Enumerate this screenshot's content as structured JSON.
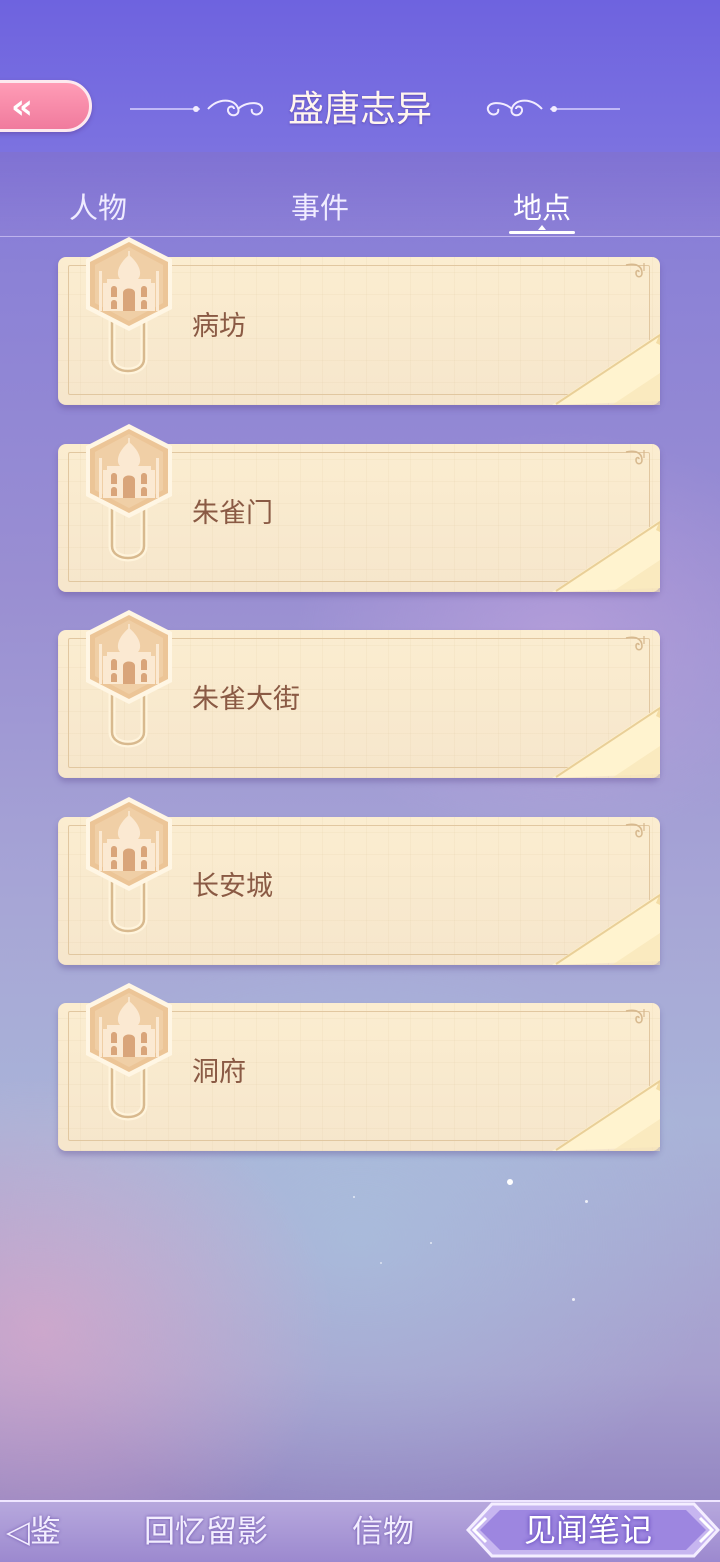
{
  "header": {
    "title": "盛唐志异",
    "back_icon": "double-chevron-left-icon",
    "back_glyph": "«"
  },
  "tabs": [
    {
      "label": "人物",
      "selected": false
    },
    {
      "label": "事件",
      "selected": false
    },
    {
      "label": "地点",
      "selected": true
    }
  ],
  "locations": [
    {
      "name": "病坊",
      "icon": "palace-badge-icon"
    },
    {
      "name": "朱雀门",
      "icon": "palace-badge-icon"
    },
    {
      "name": "朱雀大街",
      "icon": "palace-badge-icon"
    },
    {
      "name": "长安城",
      "icon": "palace-badge-icon"
    },
    {
      "name": "洞府",
      "icon": "palace-badge-icon"
    }
  ],
  "bottom_nav": [
    {
      "label": "图鉴",
      "visible_text": "鉴",
      "selected": false
    },
    {
      "label": "回忆留影",
      "selected": false
    },
    {
      "label": "信物",
      "selected": false
    },
    {
      "label": "见闻笔记",
      "selected": true
    }
  ],
  "colors": {
    "header": "#6e63df",
    "back_button": "#f07b9d",
    "card": "#f8e9d0",
    "card_text": "#8a5a44",
    "badge": "#e7bf91"
  }
}
